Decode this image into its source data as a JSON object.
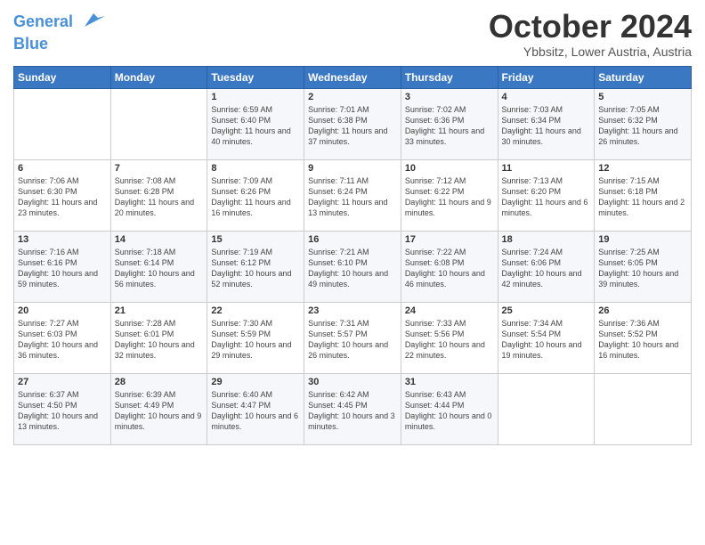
{
  "header": {
    "logo_line1": "General",
    "logo_line2": "Blue",
    "month_title": "October 2024",
    "location": "Ybbsitz, Lower Austria, Austria"
  },
  "days_of_week": [
    "Sunday",
    "Monday",
    "Tuesday",
    "Wednesday",
    "Thursday",
    "Friday",
    "Saturday"
  ],
  "weeks": [
    [
      {
        "day": "",
        "sunrise": "",
        "sunset": "",
        "daylight": ""
      },
      {
        "day": "",
        "sunrise": "",
        "sunset": "",
        "daylight": ""
      },
      {
        "day": "1",
        "sunrise": "Sunrise: 6:59 AM",
        "sunset": "Sunset: 6:40 PM",
        "daylight": "Daylight: 11 hours and 40 minutes."
      },
      {
        "day": "2",
        "sunrise": "Sunrise: 7:01 AM",
        "sunset": "Sunset: 6:38 PM",
        "daylight": "Daylight: 11 hours and 37 minutes."
      },
      {
        "day": "3",
        "sunrise": "Sunrise: 7:02 AM",
        "sunset": "Sunset: 6:36 PM",
        "daylight": "Daylight: 11 hours and 33 minutes."
      },
      {
        "day": "4",
        "sunrise": "Sunrise: 7:03 AM",
        "sunset": "Sunset: 6:34 PM",
        "daylight": "Daylight: 11 hours and 30 minutes."
      },
      {
        "day": "5",
        "sunrise": "Sunrise: 7:05 AM",
        "sunset": "Sunset: 6:32 PM",
        "daylight": "Daylight: 11 hours and 26 minutes."
      }
    ],
    [
      {
        "day": "6",
        "sunrise": "Sunrise: 7:06 AM",
        "sunset": "Sunset: 6:30 PM",
        "daylight": "Daylight: 11 hours and 23 minutes."
      },
      {
        "day": "7",
        "sunrise": "Sunrise: 7:08 AM",
        "sunset": "Sunset: 6:28 PM",
        "daylight": "Daylight: 11 hours and 20 minutes."
      },
      {
        "day": "8",
        "sunrise": "Sunrise: 7:09 AM",
        "sunset": "Sunset: 6:26 PM",
        "daylight": "Daylight: 11 hours and 16 minutes."
      },
      {
        "day": "9",
        "sunrise": "Sunrise: 7:11 AM",
        "sunset": "Sunset: 6:24 PM",
        "daylight": "Daylight: 11 hours and 13 minutes."
      },
      {
        "day": "10",
        "sunrise": "Sunrise: 7:12 AM",
        "sunset": "Sunset: 6:22 PM",
        "daylight": "Daylight: 11 hours and 9 minutes."
      },
      {
        "day": "11",
        "sunrise": "Sunrise: 7:13 AM",
        "sunset": "Sunset: 6:20 PM",
        "daylight": "Daylight: 11 hours and 6 minutes."
      },
      {
        "day": "12",
        "sunrise": "Sunrise: 7:15 AM",
        "sunset": "Sunset: 6:18 PM",
        "daylight": "Daylight: 11 hours and 2 minutes."
      }
    ],
    [
      {
        "day": "13",
        "sunrise": "Sunrise: 7:16 AM",
        "sunset": "Sunset: 6:16 PM",
        "daylight": "Daylight: 10 hours and 59 minutes."
      },
      {
        "day": "14",
        "sunrise": "Sunrise: 7:18 AM",
        "sunset": "Sunset: 6:14 PM",
        "daylight": "Daylight: 10 hours and 56 minutes."
      },
      {
        "day": "15",
        "sunrise": "Sunrise: 7:19 AM",
        "sunset": "Sunset: 6:12 PM",
        "daylight": "Daylight: 10 hours and 52 minutes."
      },
      {
        "day": "16",
        "sunrise": "Sunrise: 7:21 AM",
        "sunset": "Sunset: 6:10 PM",
        "daylight": "Daylight: 10 hours and 49 minutes."
      },
      {
        "day": "17",
        "sunrise": "Sunrise: 7:22 AM",
        "sunset": "Sunset: 6:08 PM",
        "daylight": "Daylight: 10 hours and 46 minutes."
      },
      {
        "day": "18",
        "sunrise": "Sunrise: 7:24 AM",
        "sunset": "Sunset: 6:06 PM",
        "daylight": "Daylight: 10 hours and 42 minutes."
      },
      {
        "day": "19",
        "sunrise": "Sunrise: 7:25 AM",
        "sunset": "Sunset: 6:05 PM",
        "daylight": "Daylight: 10 hours and 39 minutes."
      }
    ],
    [
      {
        "day": "20",
        "sunrise": "Sunrise: 7:27 AM",
        "sunset": "Sunset: 6:03 PM",
        "daylight": "Daylight: 10 hours and 36 minutes."
      },
      {
        "day": "21",
        "sunrise": "Sunrise: 7:28 AM",
        "sunset": "Sunset: 6:01 PM",
        "daylight": "Daylight: 10 hours and 32 minutes."
      },
      {
        "day": "22",
        "sunrise": "Sunrise: 7:30 AM",
        "sunset": "Sunset: 5:59 PM",
        "daylight": "Daylight: 10 hours and 29 minutes."
      },
      {
        "day": "23",
        "sunrise": "Sunrise: 7:31 AM",
        "sunset": "Sunset: 5:57 PM",
        "daylight": "Daylight: 10 hours and 26 minutes."
      },
      {
        "day": "24",
        "sunrise": "Sunrise: 7:33 AM",
        "sunset": "Sunset: 5:56 PM",
        "daylight": "Daylight: 10 hours and 22 minutes."
      },
      {
        "day": "25",
        "sunrise": "Sunrise: 7:34 AM",
        "sunset": "Sunset: 5:54 PM",
        "daylight": "Daylight: 10 hours and 19 minutes."
      },
      {
        "day": "26",
        "sunrise": "Sunrise: 7:36 AM",
        "sunset": "Sunset: 5:52 PM",
        "daylight": "Daylight: 10 hours and 16 minutes."
      }
    ],
    [
      {
        "day": "27",
        "sunrise": "Sunrise: 6:37 AM",
        "sunset": "Sunset: 4:50 PM",
        "daylight": "Daylight: 10 hours and 13 minutes."
      },
      {
        "day": "28",
        "sunrise": "Sunrise: 6:39 AM",
        "sunset": "Sunset: 4:49 PM",
        "daylight": "Daylight: 10 hours and 9 minutes."
      },
      {
        "day": "29",
        "sunrise": "Sunrise: 6:40 AM",
        "sunset": "Sunset: 4:47 PM",
        "daylight": "Daylight: 10 hours and 6 minutes."
      },
      {
        "day": "30",
        "sunrise": "Sunrise: 6:42 AM",
        "sunset": "Sunset: 4:45 PM",
        "daylight": "Daylight: 10 hours and 3 minutes."
      },
      {
        "day": "31",
        "sunrise": "Sunrise: 6:43 AM",
        "sunset": "Sunset: 4:44 PM",
        "daylight": "Daylight: 10 hours and 0 minutes."
      },
      {
        "day": "",
        "sunrise": "",
        "sunset": "",
        "daylight": ""
      },
      {
        "day": "",
        "sunrise": "",
        "sunset": "",
        "daylight": ""
      }
    ]
  ]
}
